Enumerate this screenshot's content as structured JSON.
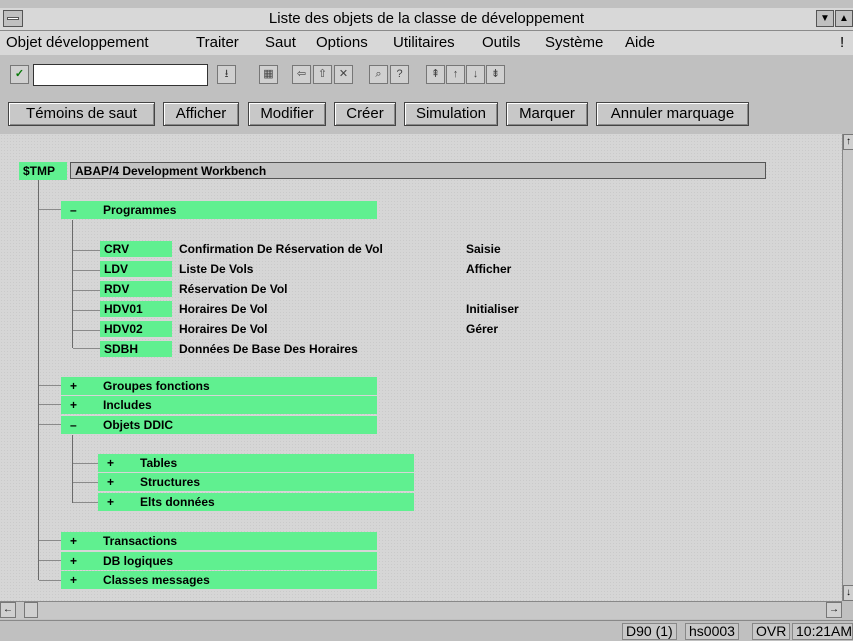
{
  "window": {
    "title": "Liste des objets de la classe de développement"
  },
  "menubar": {
    "items": [
      {
        "label": "Objet développement"
      },
      {
        "label": "Traiter"
      },
      {
        "label": "Saut"
      },
      {
        "label": "Options"
      },
      {
        "label": "Utilitaires"
      },
      {
        "label": "Outils"
      },
      {
        "label": "Système"
      },
      {
        "label": "Aide"
      }
    ],
    "help_marker": "!"
  },
  "toolbar": {
    "command_field": {
      "value": ""
    },
    "icons": [
      "check-icon",
      "dropdown-icon",
      "save-icon",
      "back-icon",
      "exit-icon",
      "cancel-icon",
      "find-icon",
      "find-next-icon",
      "first-page-icon",
      "prev-page-icon",
      "next-page-icon",
      "last-page-icon"
    ]
  },
  "app_toolbar": {
    "buttons": [
      {
        "label": "Témoins de saut"
      },
      {
        "label": "Afficher"
      },
      {
        "label": "Modifier"
      },
      {
        "label": "Créer"
      },
      {
        "label": "Simulation"
      },
      {
        "label": "Marquer"
      },
      {
        "label": "Annuler marquage"
      }
    ]
  },
  "tree": {
    "root": {
      "code": "$TMP",
      "label": "ABAP/4 Development Workbench"
    },
    "programmes": {
      "toggle": "–",
      "label": "Programmes",
      "items": [
        {
          "code": "CRV",
          "name": "Confirmation De Réservation de Vol",
          "action": "Saisie"
        },
        {
          "code": "LDV",
          "name": "Liste De Vols",
          "action": "Afficher"
        },
        {
          "code": "RDV",
          "name": "Réservation De Vol",
          "action": ""
        },
        {
          "code": "HDV01",
          "name": "Horaires De Vol",
          "action": "Initialiser"
        },
        {
          "code": "HDV02",
          "name": "Horaires De Vol",
          "action": "Gérer"
        },
        {
          "code": "SDBH",
          "name": "Données De Base Des Horaires",
          "action": ""
        }
      ]
    },
    "groupes_fonctions": {
      "toggle": "+",
      "label": "Groupes fonctions"
    },
    "includes": {
      "toggle": "+",
      "label": "Includes"
    },
    "objets_ddic": {
      "toggle": "–",
      "label": "Objets DDIC",
      "children": [
        {
          "toggle": "+",
          "label": "Tables"
        },
        {
          "toggle": "+",
          "label": "Structures"
        },
        {
          "toggle": "+",
          "label": "Elts données"
        }
      ]
    },
    "transactions": {
      "toggle": "+",
      "label": "Transactions"
    },
    "db_logiques": {
      "toggle": "+",
      "label": "DB logiques"
    },
    "classes_messages": {
      "toggle": "+",
      "label": "Classes messages"
    }
  },
  "statusbar": {
    "system": "D90 (1)",
    "host": "hs0003",
    "mode": "OVR",
    "time": "10:21AM"
  },
  "colors": {
    "node_highlight": "#60f090",
    "background": "#c0c0c0"
  }
}
